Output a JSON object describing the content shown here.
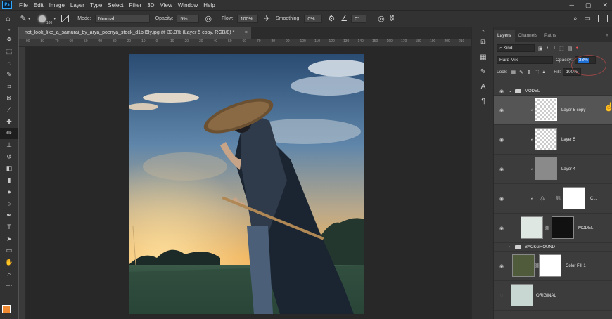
{
  "menubar": {
    "app_icon": "Ps",
    "items": [
      "File",
      "Edit",
      "Image",
      "Layer",
      "Type",
      "Select",
      "Filter",
      "3D",
      "View",
      "Window",
      "Help"
    ]
  },
  "options": {
    "brush_size": "100",
    "mode_label": "Mode:",
    "mode_value": "Normal",
    "opacity_label": "Opacity:",
    "opacity_value": "5%",
    "flow_label": "Flow:",
    "flow_value": "100%",
    "smoothing_label": "Smoothing:",
    "smoothing_value": "0%",
    "angle_value": "0°"
  },
  "document": {
    "tab_title": "not_look_like_a_samurai_by_arya_poenya_stock_d1bll6ly.jpg @ 33.3% (Layer 5 copy, RGB/8) *",
    "close": "×"
  },
  "ruler": {
    "ticks": [
      "90",
      "80",
      "70",
      "60",
      "50",
      "40",
      "30",
      "20",
      "10",
      "0",
      "10",
      "20",
      "30",
      "40",
      "50",
      "60",
      "70",
      "80",
      "90",
      "100",
      "110",
      "120",
      "130",
      "140",
      "150",
      "160",
      "170",
      "180",
      "190",
      "200",
      "210"
    ]
  },
  "panel": {
    "tabs": [
      "Layers",
      "Channels",
      "Paths"
    ],
    "kind_label": "Kind",
    "blend_mode": "Hard Mix",
    "opacity_label": "Opacity:",
    "opacity_value": "33%",
    "lock_label": "Lock:",
    "fill_label": "Fill:",
    "fill_value": "100%"
  },
  "layers": [
    {
      "name": "MODEL",
      "kind": "group-open"
    },
    {
      "name": "Layer 5 copy",
      "kind": "layer",
      "selected": true
    },
    {
      "name": "Layer 5",
      "kind": "layer"
    },
    {
      "name": "Layer 4",
      "kind": "layer"
    },
    {
      "name": "C...",
      "kind": "adjustment"
    },
    {
      "name": "MODEL",
      "kind": "masked"
    },
    {
      "name": "BACKGROUND",
      "kind": "group-closed"
    },
    {
      "name": "Color Fill 1",
      "kind": "fill"
    },
    {
      "name": "ORIGINAL",
      "kind": "layer"
    }
  ],
  "colors": {
    "accent": "#31a8ff",
    "foreground": "#f08a32",
    "background": "#ffffff",
    "selection": "#1e6fd6"
  }
}
